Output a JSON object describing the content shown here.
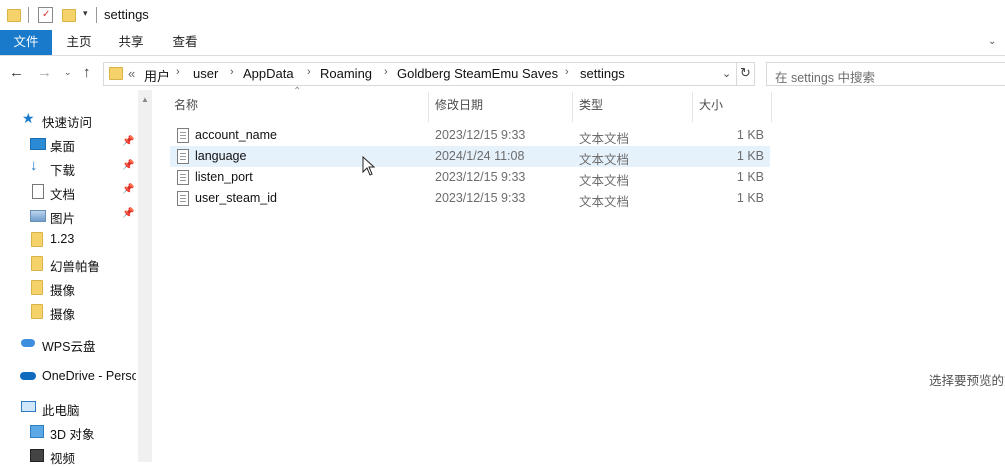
{
  "window": {
    "title": "settings"
  },
  "ribbon": {
    "tabs": [
      "文件",
      "主页",
      "共享",
      "查看"
    ]
  },
  "address": {
    "overflow": "«",
    "crumbs": [
      "用户",
      "user",
      "AppData",
      "Roaming",
      "Goldberg SteamEmu Saves",
      "settings"
    ]
  },
  "search": {
    "placeholder": "在 settings 中搜索"
  },
  "sidebar": {
    "quick_access": "快速访问",
    "items": [
      {
        "label": "桌面",
        "icon": "desktop-icon",
        "pinned": true
      },
      {
        "label": "下载",
        "icon": "download-icon",
        "pinned": true
      },
      {
        "label": "文档",
        "icon": "document-icon",
        "pinned": true
      },
      {
        "label": "图片",
        "icon": "picture-icon",
        "pinned": true
      },
      {
        "label": "1.23",
        "icon": "folder-icon",
        "pinned": false
      },
      {
        "label": "幻兽帕鲁",
        "icon": "folder-icon",
        "pinned": false
      },
      {
        "label": "摄像",
        "icon": "folder-icon",
        "pinned": false
      },
      {
        "label": "摄像",
        "icon": "folder-icon",
        "pinned": false
      }
    ],
    "wps": "WPS云盘",
    "onedrive": "OneDrive - Perso",
    "this_pc": "此电脑",
    "pc_items": [
      "3D 对象",
      "视频"
    ]
  },
  "file_list": {
    "headers": {
      "name": "名称",
      "date": "修改日期",
      "type": "类型",
      "size": "大小"
    },
    "rows": [
      {
        "name": "account_name",
        "date": "2023/12/15 9:33",
        "type": "文本文档",
        "size": "1 KB"
      },
      {
        "name": "language",
        "date": "2024/1/24 11:08",
        "type": "文本文档",
        "size": "1 KB"
      },
      {
        "name": "listen_port",
        "date": "2023/12/15 9:33",
        "type": "文本文档",
        "size": "1 KB"
      },
      {
        "name": "user_steam_id",
        "date": "2023/12/15 9:33",
        "type": "文本文档",
        "size": "1 KB"
      }
    ]
  },
  "preview": {
    "text": "选择要预览的文"
  },
  "colors": {
    "accent": "#1979ca",
    "hover_row": "#e5f1fb"
  }
}
